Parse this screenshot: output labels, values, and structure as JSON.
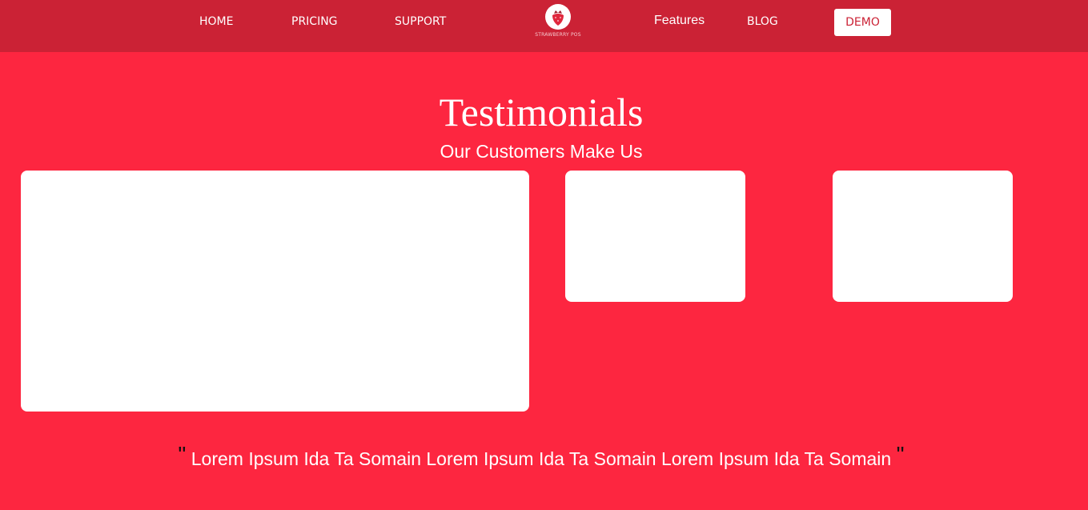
{
  "nav": {
    "items": [
      "HOME",
      "PRICING",
      "SUPPORT",
      "Features",
      "BLOG"
    ],
    "logo_text": "STRAWBERRY POS",
    "demo_label": "DEMO"
  },
  "colors": {
    "page_background": "#fd2640",
    "navbar_background": "#cb2235",
    "card_background": "#ffffff"
  },
  "section": {
    "title": "Testimonials",
    "subtitle": "Our Customers Make Us"
  },
  "testimonial": {
    "open_quote": "\"",
    "text": "Lorem Ipsum Ida Ta Somain Lorem Ipsum Ida Ta Somain Lorem Ipsum Ida Ta Somain",
    "close_quote": "\""
  }
}
